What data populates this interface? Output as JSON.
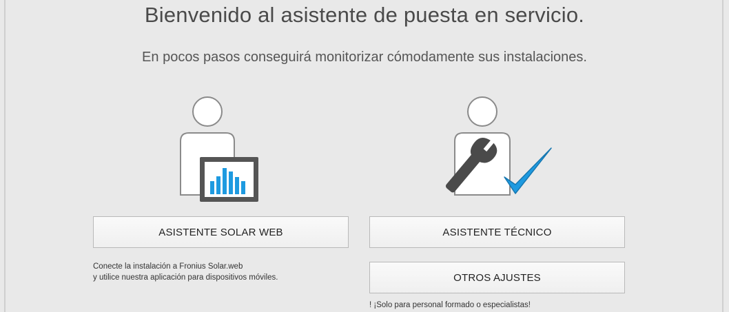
{
  "header": {
    "title": "Bienvenido al asistente de puesta en servicio.",
    "subtitle": "En pocos pasos conseguirá monitorizar cómodamente sus instalaciones."
  },
  "solarweb": {
    "icon": "user-with-chart-icon",
    "button_label": "ASISTENTE SOLAR WEB",
    "desc_line1": "Conecte la instalación a Fronius Solar.web",
    "desc_line2": "y utilice nuestra aplicación para dispositivos móviles."
  },
  "technician": {
    "icon": "technician-wrench-check-icon",
    "button_label": "ASISTENTE TÉCNICO",
    "other_button_label": "OTROS AJUSTES",
    "warning": "! ¡Solo para personal formado o especialistas!"
  },
  "colors": {
    "accent": "#1e9ae0",
    "tablet_frame": "#555555",
    "wrench": "#4a4a4a"
  }
}
